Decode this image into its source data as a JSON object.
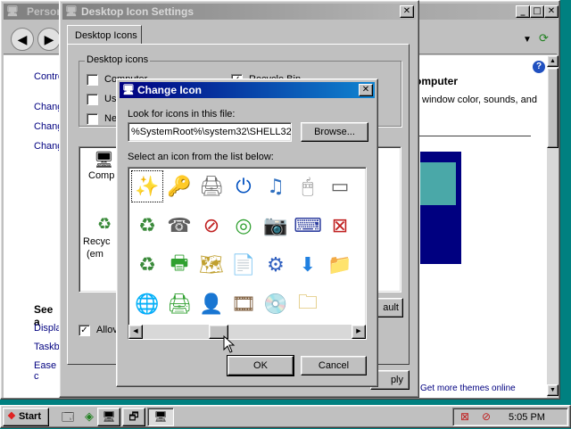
{
  "bg_window": {
    "title": "Personalization",
    "side_links": [
      "Control Panel Home",
      "Change desktop icons",
      "Change mouse pointers",
      "Change your account picture"
    ],
    "side_links_visible": [
      "Contro",
      "Chang",
      "Chang",
      "Chang"
    ],
    "see_also_heading": "See a",
    "see_also_links": [
      "Displa",
      "Taskb",
      "Ease c"
    ],
    "right_heading": "omputer",
    "right_text": "window color, sounds, and",
    "bottom_text": "Get more themes online",
    "help_glyph": "?"
  },
  "desktop_icon_settings": {
    "title": "Desktop Icon Settings",
    "tab": "Desktop Icons",
    "group_label": "Desktop icons",
    "checkboxes": [
      {
        "label": "Computer",
        "checked": false
      },
      {
        "label": "Recycle Bin",
        "checked": true
      },
      {
        "label": "Us",
        "checked": false
      },
      {
        "label": "Ne",
        "checked": false
      }
    ],
    "preview_labels": [
      "Comp",
      "Recyc",
      "(em"
    ],
    "allow_label": "Allov",
    "allow_checked": true,
    "default_btn": "ault",
    "apply_btn": "ply"
  },
  "change_icon": {
    "title": "Change Icon",
    "look_label": "Look for icons in this file:",
    "path_value": "%SystemRoot%\\system32\\SHELL32",
    "browse_btn": "Browse...",
    "select_label": "Select an icon from the list below:",
    "icons": [
      {
        "name": "wand-icon",
        "glyph": "✨",
        "color": "#e0b000",
        "selected": true
      },
      {
        "name": "keys-icon",
        "glyph": "🔑",
        "color": "#c8a000"
      },
      {
        "name": "printer-icon",
        "glyph": "🖨",
        "color": "#707070"
      },
      {
        "name": "power-icon",
        "glyph": "⏻",
        "color": "#0050c0"
      },
      {
        "name": "music-file-icon",
        "glyph": "♫",
        "color": "#3070c0"
      },
      {
        "name": "mouse-icon",
        "glyph": "🖱",
        "color": "#808080"
      },
      {
        "name": "drive-icon",
        "glyph": "▭",
        "color": "#606060"
      },
      {
        "name": "recycle-bin-icon",
        "glyph": "♻",
        "color": "#3a8a3a"
      },
      {
        "name": "fax-icon",
        "glyph": "☎",
        "color": "#606060"
      },
      {
        "name": "no-entry-icon",
        "glyph": "⊘",
        "color": "#c02020"
      },
      {
        "name": "cd-icon",
        "glyph": "◎",
        "color": "#30a030"
      },
      {
        "name": "camera-icon",
        "glyph": "📷",
        "color": "#505050"
      },
      {
        "name": "keyboard-icon",
        "glyph": "⌨",
        "color": "#3040a0"
      },
      {
        "name": "network-error-icon",
        "glyph": "⊠",
        "color": "#c02020"
      },
      {
        "name": "recycle-full-icon",
        "glyph": "♻",
        "color": "#3a8a3a"
      },
      {
        "name": "printer-check-icon",
        "glyph": "🖶",
        "color": "#30a030"
      },
      {
        "name": "map-folder-icon",
        "glyph": "🗺",
        "color": "#c0a030"
      },
      {
        "name": "documents-icon",
        "glyph": "📄",
        "color": "#404040"
      },
      {
        "name": "setup-icon",
        "glyph": "⚙",
        "color": "#3060c0"
      },
      {
        "name": "download-icon",
        "glyph": "⬇",
        "color": "#2080e0"
      },
      {
        "name": "folder-icon",
        "glyph": "📁",
        "color": "#d0a830"
      },
      {
        "name": "globe-network-icon",
        "glyph": "🌐",
        "color": "#2080c0"
      },
      {
        "name": "printer-share-icon",
        "glyph": "🖨",
        "color": "#30a030"
      },
      {
        "name": "user-key-icon",
        "glyph": "👤",
        "color": "#a06030"
      },
      {
        "name": "film-icon",
        "glyph": "🎞",
        "color": "#806040"
      },
      {
        "name": "cd-music-icon",
        "glyph": "💿",
        "color": "#30a030"
      },
      {
        "name": "zip-folder-icon",
        "glyph": "🗀",
        "color": "#d0a830"
      }
    ],
    "ok_btn": "OK",
    "cancel_btn": "Cancel"
  },
  "taskbar": {
    "start_label": "Start",
    "time": "5:05 PM"
  }
}
